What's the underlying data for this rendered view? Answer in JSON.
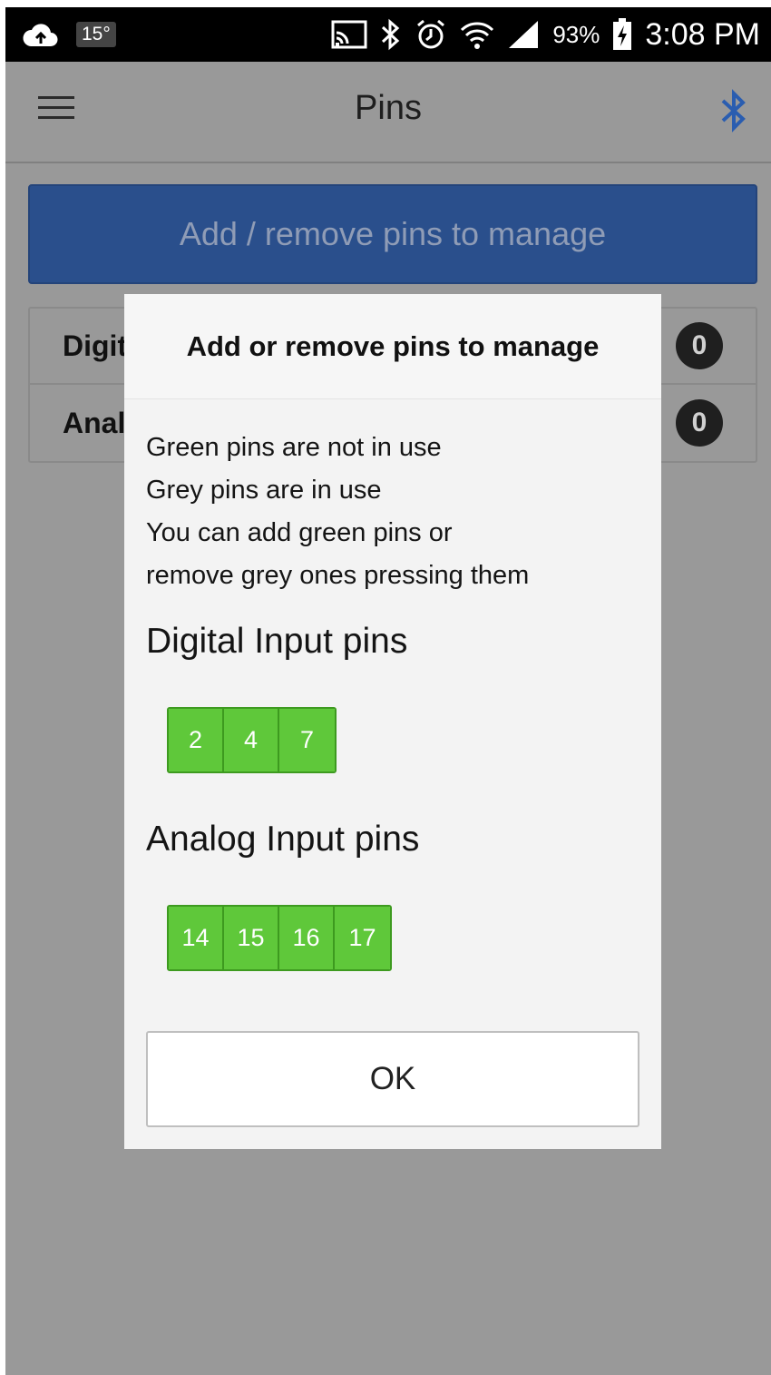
{
  "status_bar": {
    "temperature": "15°",
    "battery": "93%",
    "time": "3:08 PM",
    "icons": [
      "cloud-upload-icon",
      "cast-icon",
      "bluetooth-icon",
      "alarm-icon",
      "wifi-icon",
      "signal-icon",
      "battery-charging-icon"
    ]
  },
  "app_bar": {
    "title": "Pins",
    "menu_icon": "menu-icon",
    "bluetooth_icon": "bluetooth-icon",
    "accent": "#2a5db0"
  },
  "main": {
    "add_button_label": "Add / remove pins to manage",
    "list": [
      {
        "label": "Digital Input pins",
        "count": "0"
      },
      {
        "label": "Analog Input pins",
        "count": "0"
      }
    ]
  },
  "dialog": {
    "title": "Add or remove pins to manage",
    "help_lines": [
      "Green pins are not in use",
      "Grey pins are in use",
      "You can add green pins or",
      "remove grey ones pressing them"
    ],
    "digital_title": "Digital Input pins",
    "digital_pins": [
      "2",
      "4",
      "7"
    ],
    "analog_title": "Analog Input pins",
    "analog_pins": [
      "14",
      "15",
      "16",
      "17"
    ],
    "ok_label": "OK",
    "pin_color": "#5fc83a"
  }
}
